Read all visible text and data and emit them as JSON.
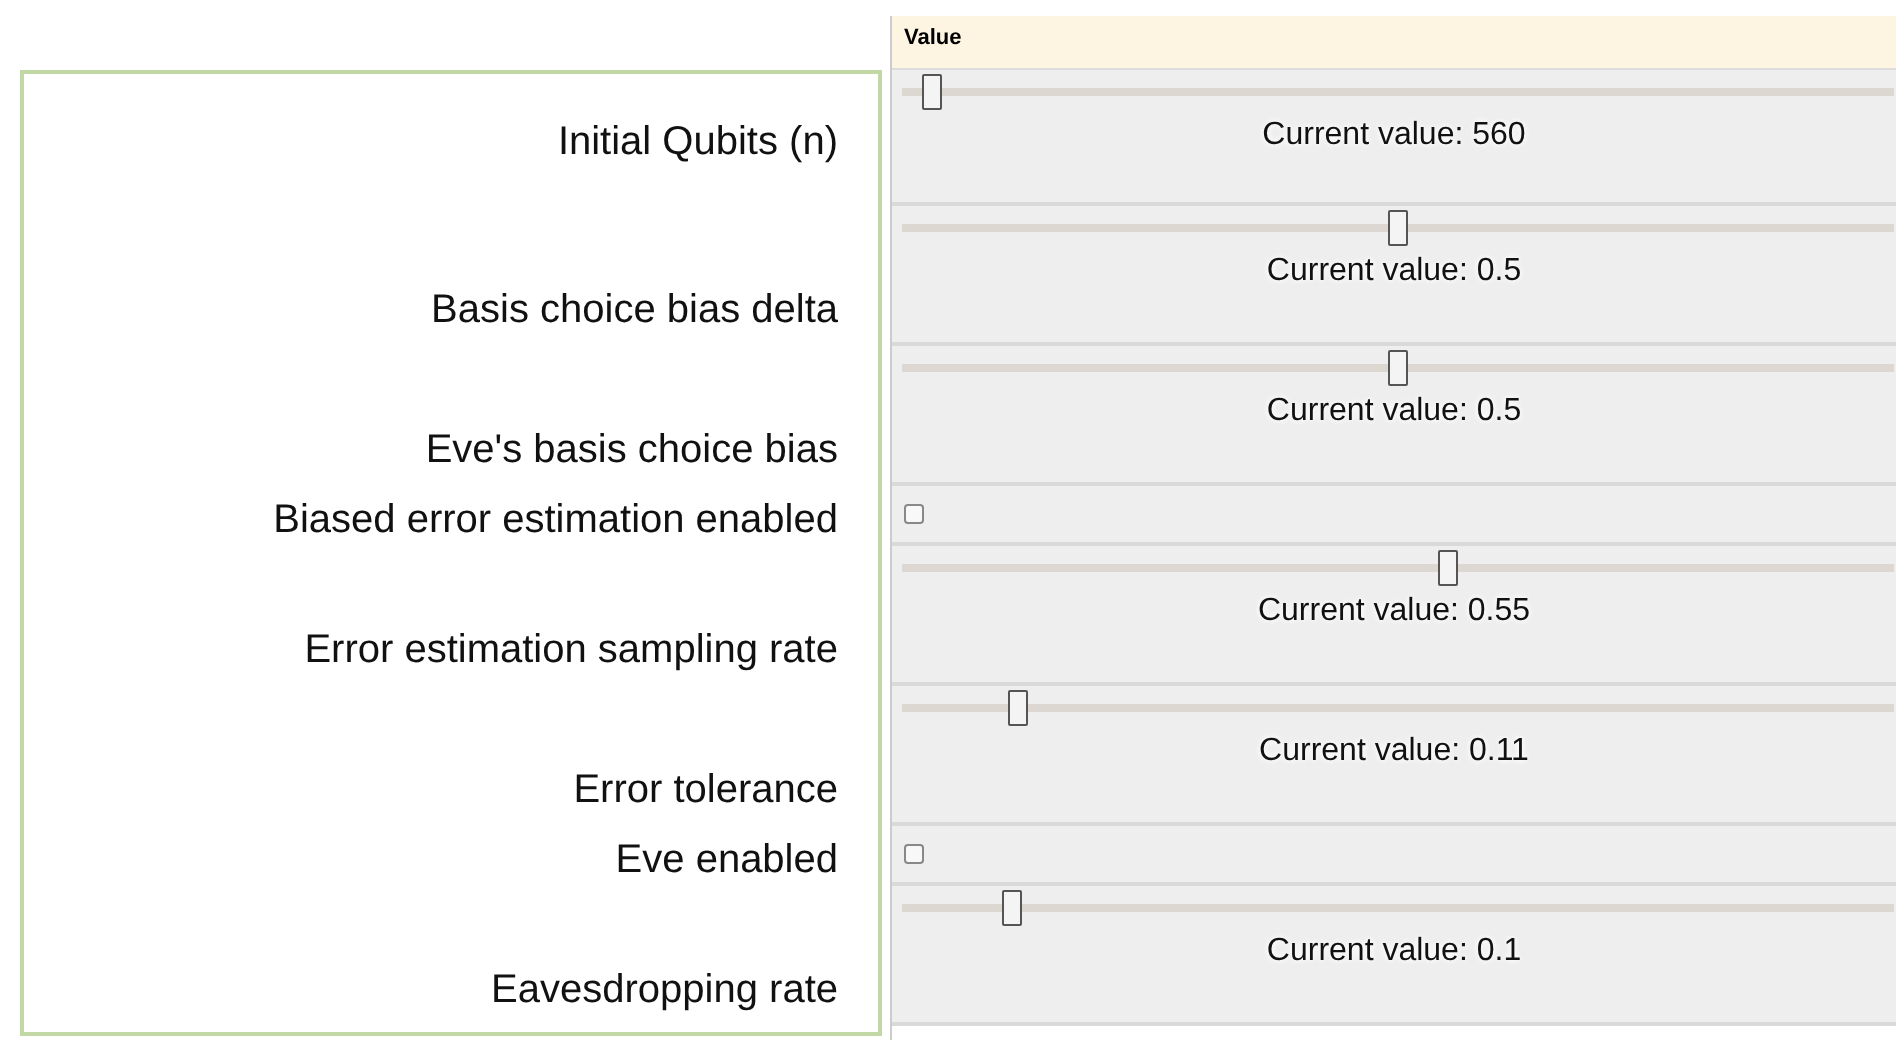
{
  "value_header": "Value",
  "parameters": [
    {
      "label": "Initial Qubits (n)",
      "kind": "slider",
      "level": 0.03,
      "reading": "Current value: 560"
    },
    {
      "label": "Basis choice bias delta",
      "kind": "slider",
      "level": 0.5,
      "reading": "Current value: 0.5"
    },
    {
      "label": "Eve's basis choice bias",
      "kind": "slider",
      "level": 0.5,
      "reading": "Current value: 0.5"
    },
    {
      "label": "Biased error estimation enabled",
      "kind": "checkbox",
      "checked": false
    },
    {
      "label": "Error estimation sampling rate",
      "kind": "slider",
      "level": 0.55,
      "reading": "Current value: 0.55"
    },
    {
      "label": "Error tolerance",
      "kind": "slider",
      "level": 0.117,
      "reading": "Current value: 0.11"
    },
    {
      "label": "Eve enabled",
      "kind": "checkbox",
      "checked": false
    },
    {
      "label": "Eavesdropping rate",
      "kind": "slider",
      "level": 0.11,
      "reading": "Current value: 0.1"
    }
  ]
}
